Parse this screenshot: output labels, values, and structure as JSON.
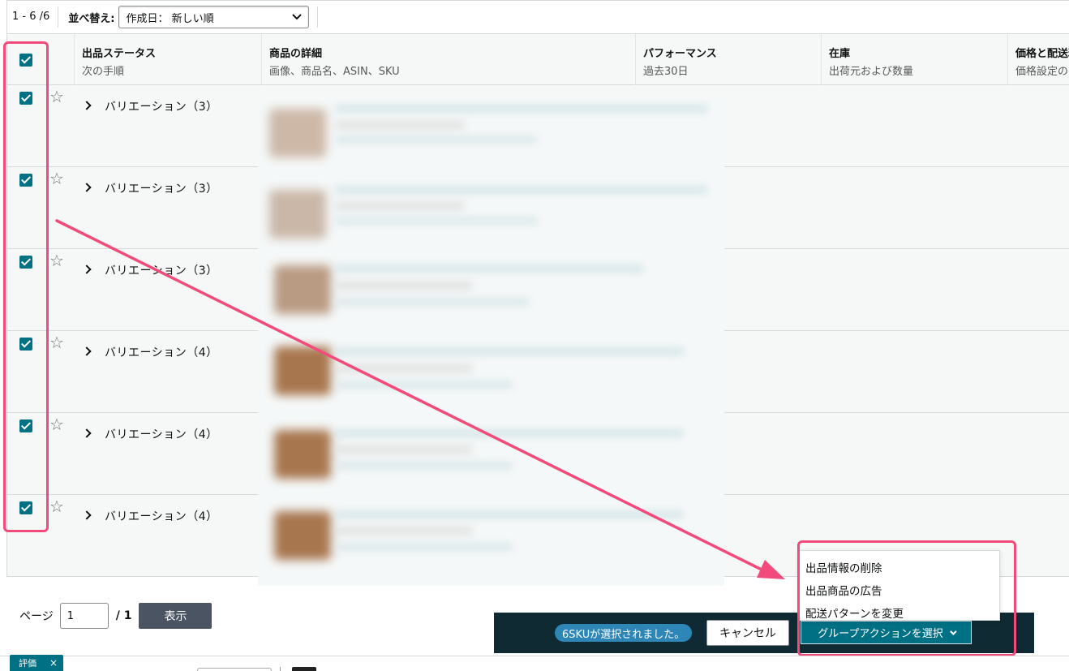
{
  "toolbar": {
    "count": "1 - 6 /6",
    "sort_label": "並べ替え:",
    "sort_value": "作成日：  新しい順"
  },
  "table": {
    "columns": [
      {
        "title": "出品ステータス",
        "subtitle": "次の手順"
      },
      {
        "title": "商品の詳細",
        "subtitle": "画像、商品名、ASIN、SKU"
      },
      {
        "title": "パフォーマンス",
        "subtitle": "過去30日"
      },
      {
        "title": "在庫",
        "subtitle": "出荷元および数量"
      },
      {
        "title": "価格と配送料",
        "subtitle": "価格設定の"
      }
    ],
    "rows": [
      {
        "label": "バリエーション（3）",
        "checked": true
      },
      {
        "label": "バリエーション（3）",
        "checked": true
      },
      {
        "label": "バリエーション（3）",
        "checked": true
      },
      {
        "label": "バリエーション（4）",
        "checked": true
      },
      {
        "label": "バリエーション（4）",
        "checked": true
      },
      {
        "label": "バリエーション（4）",
        "checked": true
      }
    ]
  },
  "pager": {
    "label": "ページ",
    "value": "1",
    "total": "/ 1",
    "button": "表示"
  },
  "action_bar": {
    "selected": "6SKUが選択されました。",
    "cancel": "キャンセル",
    "group_action": "グループアクションを選択"
  },
  "menu": {
    "items": [
      "出品情報の削除",
      "出品商品の広告",
      "配送パターンを変更"
    ]
  },
  "footer": {
    "tag": "評価",
    "tag_close": "×"
  },
  "colors": {
    "accent": "#007185",
    "highlight": "#f24a7a",
    "action_bar": "#0f2a32",
    "badge": "#2d86b5"
  }
}
